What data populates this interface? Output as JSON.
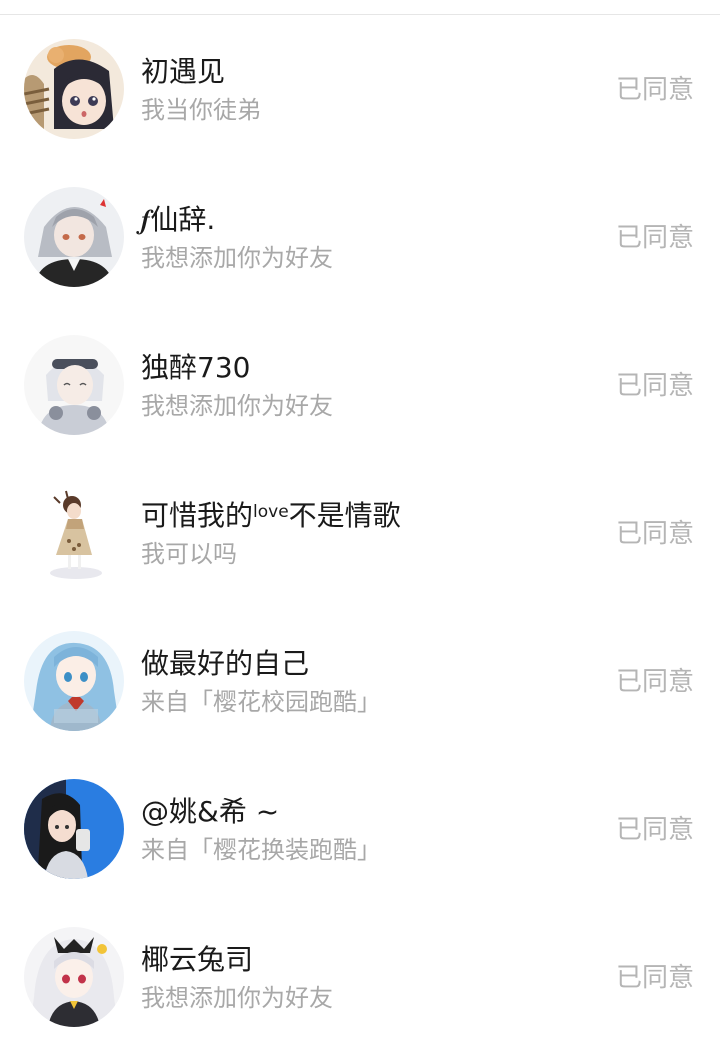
{
  "requests": [
    {
      "name": "初遇见",
      "name_sup": "",
      "name_tail": "",
      "message": "我当你徒弟",
      "status": "已同意",
      "avatar_icon": "anime-girl-with-cat-avatar"
    },
    {
      "name": "𝆑仙辞.",
      "name_sup": "",
      "name_tail": "",
      "message": "我想添加你为好友",
      "status": "已同意",
      "avatar_icon": "anime-gray-hair-avatar"
    },
    {
      "name": "独醉730",
      "name_sup": "",
      "name_tail": "",
      "message": "我想添加你为好友",
      "status": "已同意",
      "avatar_icon": "anime-boy-headphones-avatar"
    },
    {
      "name": "可惜我的",
      "name_sup": "love",
      "name_tail": "不是情歌",
      "message": "我可以吗",
      "status": "已同意",
      "avatar_icon": "chibi-girl-dress-avatar"
    },
    {
      "name": "做最好的自己",
      "name_sup": "",
      "name_tail": "",
      "message": "来自「樱花校园跑酷」",
      "status": "已同意",
      "avatar_icon": "anime-blue-hair-girl-avatar"
    },
    {
      "name": "@姚&希 ~",
      "name_sup": "",
      "name_tail": "",
      "message": "来自「樱花换装跑酷」",
      "status": "已同意",
      "avatar_icon": "anime-girl-blue-background-avatar"
    },
    {
      "name": "椰云兔司",
      "name_sup": "",
      "name_tail": "",
      "message": "我想添加你为好友",
      "status": "已同意",
      "avatar_icon": "anime-white-hair-girl-avatar"
    }
  ],
  "colors": {
    "name": "#1a1a1a",
    "message": "#a8a8a8",
    "status": "#b5b5b5",
    "divider": "#e6e6e6"
  }
}
